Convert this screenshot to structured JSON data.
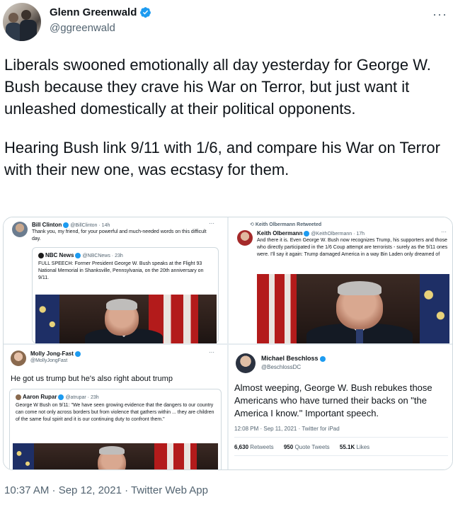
{
  "author": {
    "display_name": "Glenn Greenwald",
    "handle": "@ggreenwald",
    "more_label": "···"
  },
  "tweet": {
    "paragraphs": [
      "Liberals swooned emotionally all day yesterday for George W. Bush because they crave his War on Terror, but just want it unleashed domestically at their political opponents.",
      "Hearing Bush link 9/11 with 1/6, and compare his War on Terror with their new one, was ecstasy for them."
    ],
    "timestamp": "10:37 AM · Sep 12, 2021 · Twitter Web App"
  },
  "media": {
    "top_left": {
      "name": "Bill Clinton",
      "handle": "@BillClinton · 14h",
      "dots": "···",
      "text": "Thank you, my friend, for your powerful and much-needed words on this difficult day.",
      "quote": {
        "name": "NBC News",
        "handle": "@NBCNews · 23h",
        "text": "FULL SPEECH: Former President George W. Bush speaks at the Flight 93 National Memorial in Shanksville, Pennsylvania, on the 20th anniversary on 9/11."
      }
    },
    "top_right": {
      "retweet_label": "Keith Olbermann Retweeted",
      "name": "Keith Olbermann",
      "handle": "@KeithOlbermann · 17h",
      "dots": "···",
      "text": "And there it is. Even George W. Bush now recognizes Trump, his supporters and those who directly participated in the 1/6 Coup attempt are terrorists - surely as the 9/11 ones were. I'll say it again: Trump damaged America in a way Bin Laden only dreamed of"
    },
    "bottom_left": {
      "name": "Molly Jong-Fast",
      "handle": "@MollyJongFast",
      "dots": "···",
      "text": "He got us trump but he's also right about trump",
      "quote": {
        "name": "Aaron Rupar",
        "handle": "@atrupar · 23h",
        "text": "George W Bush on 9/11: \"We have seen growing evidence that the dangers to our country can come not only across borders but from violence that gathers within ... they are children of the same foul spirit and it is our continuing duty to confront them.\""
      }
    },
    "bottom_right": {
      "name": "Michael Beschloss",
      "handle": "@BeschlossDC",
      "text": "Almost weeping, George W. Bush rebukes those Americans who have turned their backs on \"the America I know.\"  Important speech.",
      "meta": "12:08 PM · Sep 11, 2021 · Twitter for iPad",
      "retweets_count": "6,630",
      "retweets_label": "Retweets",
      "quotes_count": "950",
      "quotes_label": "Quote Tweets",
      "likes_count": "55.1K",
      "likes_label": "Likes"
    }
  },
  "colors": {
    "verified_blue": "#1d9bf0",
    "secondary_text": "#536471",
    "primary_text": "#0f1419",
    "border": "#cfd9de"
  },
  "icons": {
    "verified": "verified-badge-icon",
    "more": "more-dots-icon",
    "retweet": "retweet-icon"
  }
}
